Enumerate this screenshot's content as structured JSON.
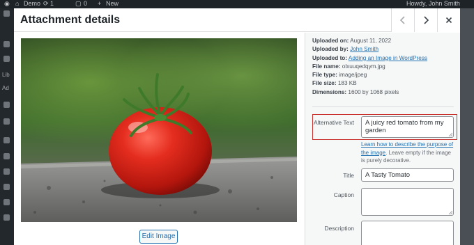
{
  "admin_bar": {
    "site_name": "Demo",
    "updates_count": "1",
    "comments_count": "0",
    "new_label": "New",
    "howdy": "Howdy, John Smith"
  },
  "background_menu": {
    "item_1": "Lib",
    "item_2": "Ad"
  },
  "modal": {
    "title": "Attachment details",
    "edit_image_label": "Edit Image",
    "photo_icon": "tomato-photo"
  },
  "details": {
    "uploaded_on_label": "Uploaded on:",
    "uploaded_on": "August 11, 2022",
    "uploaded_by_label": "Uploaded by:",
    "uploaded_by": "John Smith",
    "uploaded_to_label": "Uploaded to:",
    "uploaded_to": "Adding an Image in WordPress",
    "file_name_label": "File name:",
    "file_name": "olxuuqedqym.jpg",
    "file_type_label": "File type:",
    "file_type": "image/jpeg",
    "file_size_label": "File size:",
    "file_size": "183 KB",
    "dimensions_label": "Dimensions:",
    "dimensions": "1600 by 1068 pixels"
  },
  "fields": {
    "alt_label": "Alternative Text",
    "alt_value": "A juicy red tomato from my garden",
    "help_link": "Learn how to describe the purpose of the image",
    "help_text": ". Leave empty if the image is purely decorative.",
    "title_label": "Title",
    "title_value": "A Tasty Tomato",
    "caption_label": "Caption",
    "caption_value": "",
    "description_label": "Description",
    "description_value": ""
  },
  "colors": {
    "accent": "#2271b1",
    "highlight_border": "#c8322f",
    "admin_bar": "#1d2327"
  }
}
